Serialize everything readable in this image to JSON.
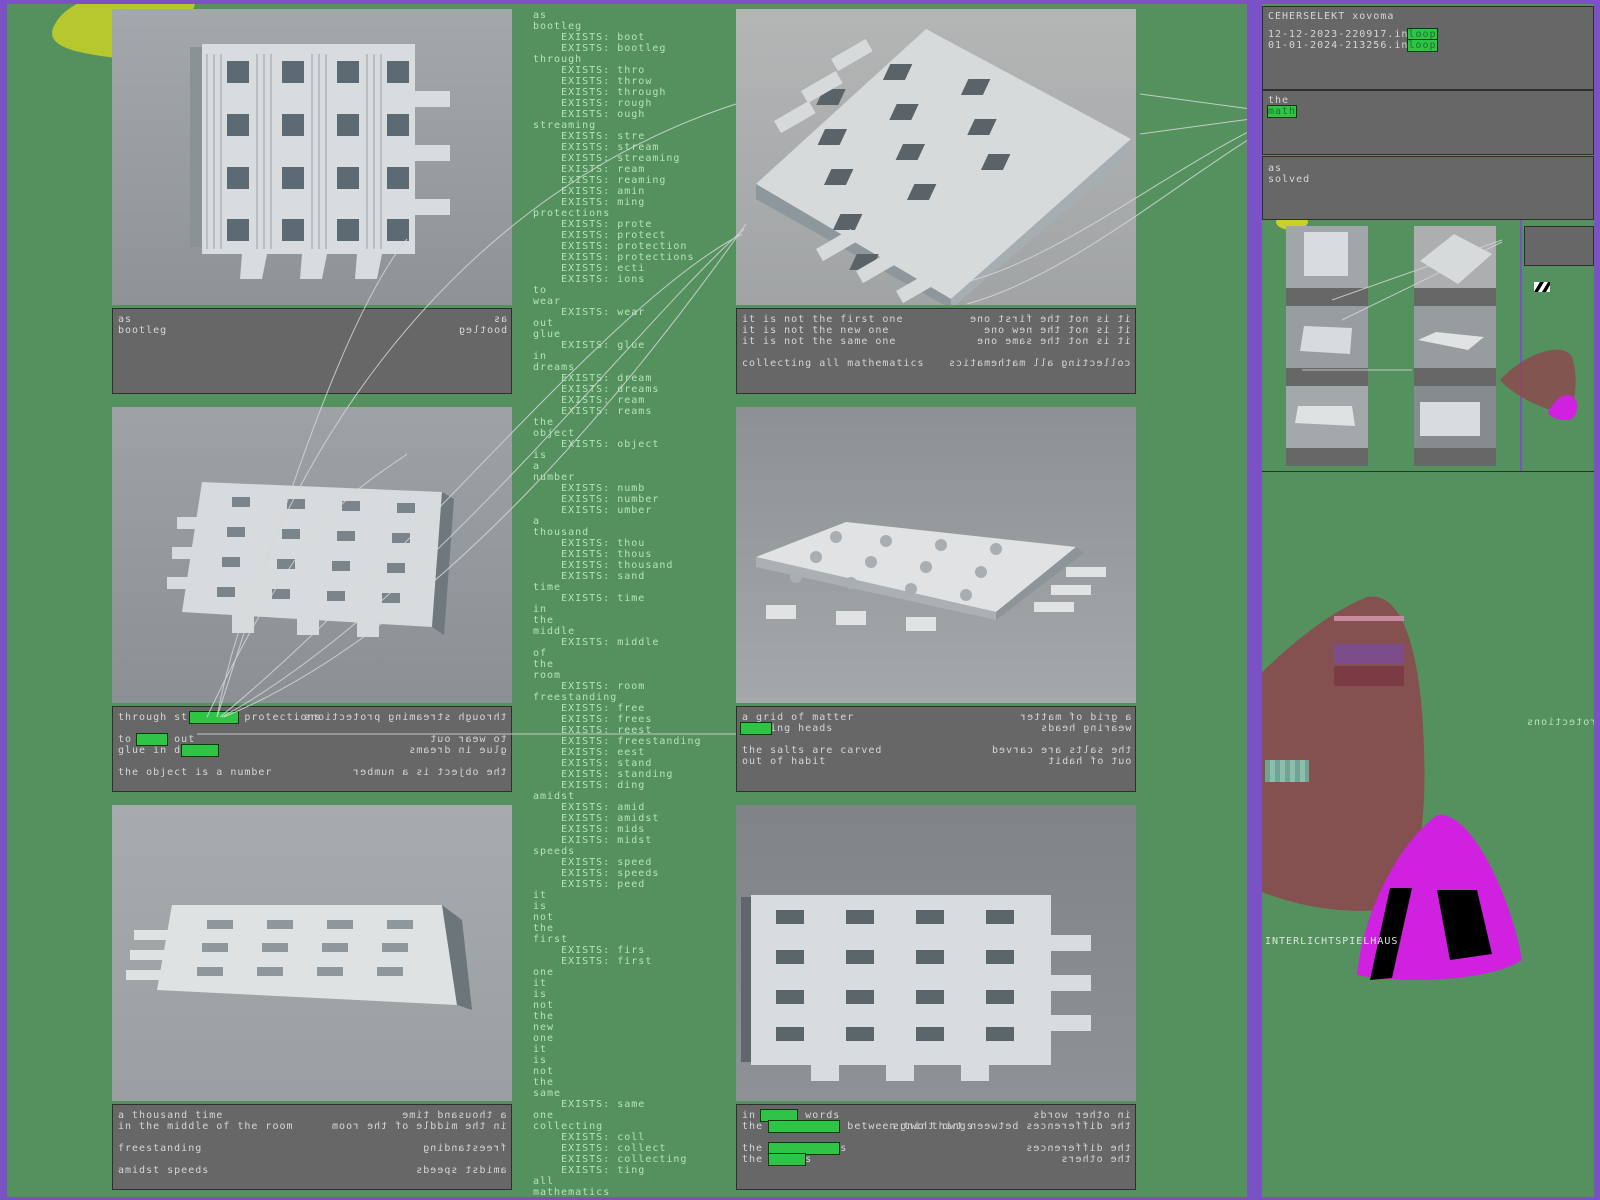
{
  "captions": [
    {
      "left_lines": [
        "as",
        "bootleg"
      ],
      "right_lines": [
        "as",
        "bootleg"
      ]
    },
    {
      "left_lines": [
        "it is not the first one",
        "it is not the new one",
        "it is not the same one",
        "",
        "collecting all mathematics"
      ],
      "right_lines": [
        "it is not the first one",
        "it is not the new one",
        "it is not the same one",
        "",
        "collecting all mathematics"
      ]
    },
    {
      "left_lines": [
        "through streaming protections",
        "",
        "to wear out",
        "glue in dreams",
        "",
        "the object is a number"
      ],
      "right_lines": [
        "through streaming protections",
        "",
        "to wear out",
        "glue in dreams",
        "",
        "the object is a number"
      ]
    },
    {
      "left_lines": [
        "a grid of matter",
        "wearing heads",
        "",
        "the salts are carved",
        "out of habit"
      ],
      "right_lines": [
        "a grid of matter",
        "wearing heads",
        "",
        "the salts are carved",
        "out of habit"
      ]
    },
    {
      "left_lines": [
        "a thousand time",
        "in the middle of the room",
        "",
        "freestanding",
        "",
        "amidst speeds"
      ],
      "right_lines": [
        "a thousand time",
        "in the middle of the room",
        "",
        "freestanding",
        "",
        "amidst speeds"
      ]
    },
    {
      "left_lines": [
        "in other words",
        "the difference between two things",
        "",
        "the differences",
        "the others"
      ],
      "right_lines": [
        "in other words",
        "the differences between two things",
        "",
        "the differences",
        "the others"
      ]
    }
  ],
  "word_column": "as\nbootleg\n    EXISTS: boot\n    EXISTS: bootleg\nthrough\n    EXISTS: thro\n    EXISTS: throw\n    EXISTS: through\n    EXISTS: rough\n    EXISTS: ough\nstreaming\n    EXISTS: stre\n    EXISTS: stream\n    EXISTS: streaming\n    EXISTS: ream\n    EXISTS: reaming\n    EXISTS: amin\n    EXISTS: ming\nprotections\n    EXISTS: prote\n    EXISTS: protect\n    EXISTS: protection\n    EXISTS: protections\n    EXISTS: ecti\n    EXISTS: ions\nto\nwear\n    EXISTS: wear\nout\nglue\n    EXISTS: glue\nin\ndreams\n    EXISTS: dream\n    EXISTS: dreams\n    EXISTS: ream\n    EXISTS: reams\nthe\nobject\n    EXISTS: object\nis\na\nnumber\n    EXISTS: numb\n    EXISTS: number\n    EXISTS: umber\na\nthousand\n    EXISTS: thou\n    EXISTS: thous\n    EXISTS: thousand\n    EXISTS: sand\ntime\n    EXISTS: time\nin\nthe\nmiddle\n    EXISTS: middle\nof\nthe\nroom\n    EXISTS: room\nfreestanding\n    EXISTS: free\n    EXISTS: frees\n    EXISTS: reest\n    EXISTS: freestanding\n    EXISTS: eest\n    EXISTS: stand\n    EXISTS: standing\n    EXISTS: ding\namidst\n    EXISTS: amid\n    EXISTS: amidst\n    EXISTS: mids\n    EXISTS: midst\nspeeds\n    EXISTS: speed\n    EXISTS: speeds\n    EXISTS: peed\nit\nis\nnot\nthe\nfirst\n    EXISTS: firs\n    EXISTS: first\none\nit\nis\nnot\nthe\nnew\none\nit\nis\nnot\nthe\nsame\n    EXISTS: same\none\ncollecting\n    EXISTS: coll\n    EXISTS: collect\n    EXISTS: collecting\n    EXISTS: ting\nall\nmathematics",
  "right_panel": {
    "header_title": "CEHERSELEKT xovoma",
    "entries": [
      "12-12-2023-220917.in",
      "01-01-2024-213256.in"
    ],
    "entry_tags": [
      "loop",
      "loop"
    ],
    "the_label": "the",
    "the_tag": "math",
    "as_label": "as",
    "solved_label": "solved",
    "overlay_label": "INTERLICHTSPIELHAUS",
    "edge_label": "protections"
  },
  "colors": {
    "background": "#55915f",
    "frame": "#7b52c6",
    "caption_bg": "#676767",
    "highlight": "#2ec446",
    "blob_red": "#8b4a4f",
    "blob_magenta": "#d020e0",
    "blob_yellow": "#c9d126"
  }
}
